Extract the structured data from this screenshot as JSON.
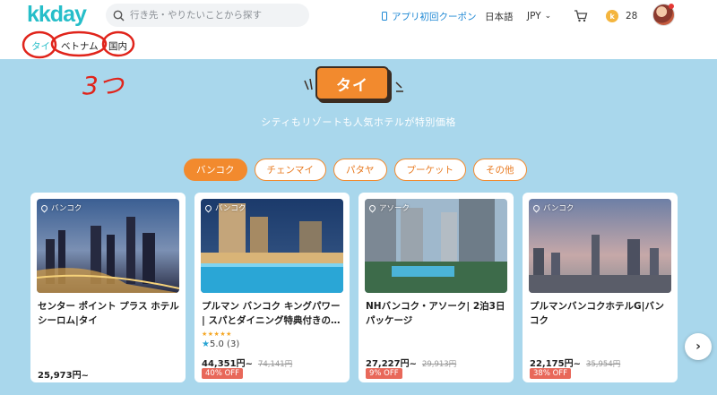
{
  "header": {
    "logo": "kkday",
    "search_placeholder": "行き先・やりたいことから探す",
    "coupon": "アプリ初回クーポン",
    "language": "日本語",
    "currency": "JPY",
    "points": "28"
  },
  "country_tabs": [
    "タイ",
    "ベトナム",
    "国内"
  ],
  "annotation_text": "3つ",
  "hero": {
    "badge": "タイ",
    "subtitle": "シティもリゾートも人気ホテルが特別価格",
    "accent_color": "#f28a2e",
    "background_color": "#a9d7ec"
  },
  "categories": [
    "バンコク",
    "チェンマイ",
    "パタヤ",
    "プーケット",
    "その他"
  ],
  "cards": [
    {
      "location": "バンコク",
      "title": "センター ポイント プラス ホテル シーロム|タイ",
      "price": "25,973円~",
      "old_price": "",
      "off": "",
      "stars": "",
      "rating": ""
    },
    {
      "location": "バンコク",
      "title": "プルマン バンコク キングパワー | スパとダイニング特典付きの…",
      "price": "44,351円~",
      "old_price": "74,141円",
      "off": "40% OFF",
      "stars": "★★★★★",
      "rating": "5.0 (3)"
    },
    {
      "location": "アソーク",
      "title": "NHバンコク・アソーク| 2泊3日パッケージ",
      "price": "27,227円~",
      "old_price": "29,913円",
      "off": "9% OFF",
      "stars": "",
      "rating": ""
    },
    {
      "location": "バンコク",
      "title": "プルマンバンコクホテルG|バンコク",
      "price": "22,175円~",
      "old_price": "35,954円",
      "off": "38% OFF",
      "stars": "",
      "rating": ""
    }
  ]
}
